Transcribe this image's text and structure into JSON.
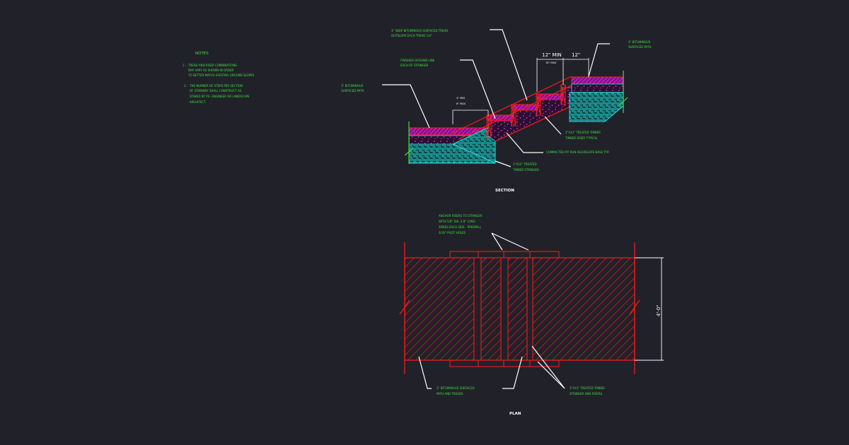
{
  "notes": {
    "heading": "NOTES",
    "items": [
      {
        "num": "1.-",
        "lines": [
          "TREAD AND RISER COMBINATIONS",
          "MAY VARY AS SHOWN IN ORDER",
          "TO BETTER MATCH EXISTING GROUND SLOPES"
        ]
      },
      {
        "num": "2.-",
        "lines": [
          "THE NUMBER OF STEPS PER SECTION",
          "OF STAIRWAY SHALL CONSTRUCT AS",
          "STAKED BY P.E. ENGINEER OR LANDSCAPE",
          "ARCHITECT."
        ]
      }
    ]
  },
  "section": {
    "title": "SECTION",
    "labels": {
      "tread": [
        "3\" DEEP BITUMINOUS SURFACED TREAD",
        "OUTSLOPE EACH TREAD 1/4\""
      ],
      "finished_grade": [
        "FINISHED GROUND LINE",
        "EACH OF STRINGER"
      ],
      "left_path": [
        "3\" BITUMINOUS",
        "SURFACED PATH"
      ],
      "right_path": [
        "3\" BITUMINOUS",
        "SURFACED PATH"
      ],
      "riser": [
        "2\"X12\" TREATED TIMBER",
        "TIMBER RISER TYPICAL"
      ],
      "aggregate": [
        "COMPACTED PIT RUN AGGREGATE BASE TYP."
      ],
      "stringer": [
        "2\"X12\" TREATED",
        "TIMBER STRINGER"
      ]
    },
    "dims": {
      "tread_min": "12\" MIN",
      "tread": "12\"",
      "tread_max": "18\" MAX",
      "riser_min": "4\" MIN",
      "riser_max": "8\" MAX"
    }
  },
  "plan": {
    "title": "PLAN",
    "labels": {
      "anchor": [
        "ANCHOR RISERS TO STRINGER",
        "WITH 5/8\" DIA. X 8\" LONG",
        "SPIKES EACH SIDE - PREDRILL",
        "3/16\" PILOT HOLES"
      ],
      "path": [
        "3\" BITUMINOUS SURFACED",
        "PATH AND TREADS"
      ],
      "stringers": [
        "2\"X12\" TREATED TIMBER",
        "STRINGER AND RISERS"
      ]
    },
    "dims": {
      "width": "4'-0\""
    }
  },
  "colors": {
    "background": "#212129",
    "linework": "#ff1a1a",
    "text": "#3fe03f",
    "accent_magenta": "#e020e0",
    "accent_cyan": "#27e0e0",
    "leader": "#ffffff"
  }
}
